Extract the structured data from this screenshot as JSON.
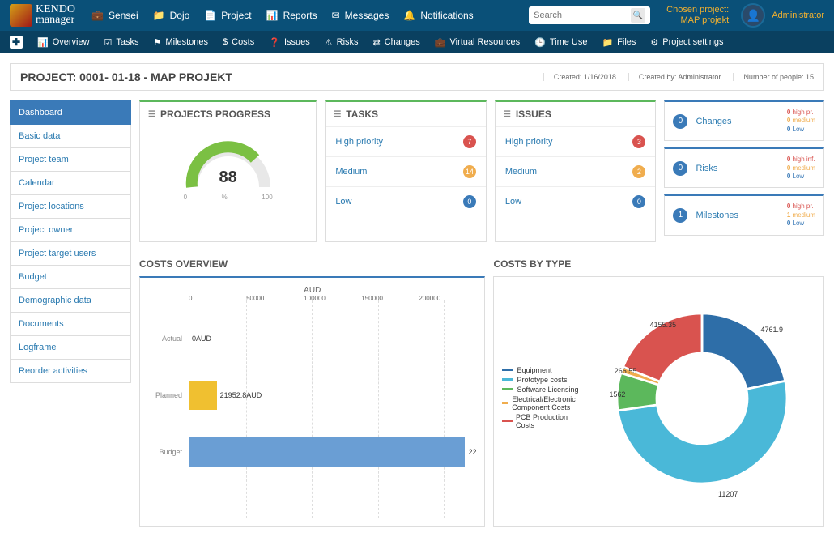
{
  "logo": {
    "line1": "KENDO",
    "line2": "manager"
  },
  "topnav": [
    {
      "icon": "briefcase",
      "label": "Sensei"
    },
    {
      "icon": "folder",
      "label": "Dojo"
    },
    {
      "icon": "document",
      "label": "Project"
    },
    {
      "icon": "chart",
      "label": "Reports"
    },
    {
      "icon": "envelope",
      "label": "Messages"
    },
    {
      "icon": "bell",
      "label": "Notifications"
    }
  ],
  "search": {
    "placeholder": "Search"
  },
  "chosen": {
    "line1": "Chosen project:",
    "line2": "MAP projekt"
  },
  "admin": {
    "label": "Administrator"
  },
  "subnav": [
    {
      "icon": "chart",
      "label": "Overview"
    },
    {
      "icon": "tasks",
      "label": "Tasks"
    },
    {
      "icon": "flag",
      "label": "Milestones"
    },
    {
      "icon": "dollar",
      "label": "Costs"
    },
    {
      "icon": "question",
      "label": "Issues"
    },
    {
      "icon": "warning",
      "label": "Risks"
    },
    {
      "icon": "exchange",
      "label": "Changes"
    },
    {
      "icon": "briefcase",
      "label": "Virtual Resources"
    },
    {
      "icon": "clock",
      "label": "Time Use"
    },
    {
      "icon": "folder",
      "label": "Files"
    },
    {
      "icon": "gear",
      "label": "Project settings"
    }
  ],
  "project": {
    "title": "PROJECT: 0001- 01-18 - MAP PROJEKT",
    "meta": [
      "Created: 1/16/2018",
      "Created by: Administrator",
      "Number of people: 15"
    ]
  },
  "sidebar": [
    "Dashboard",
    "Basic data",
    "Project team",
    "Calendar",
    "Project locations",
    "Project owner",
    "Project target users",
    "Budget",
    "Demographic data",
    "Documents",
    "Logframe",
    "Reorder activities"
  ],
  "cards": {
    "progress": {
      "title": "PROJECTS PROGRESS",
      "value": "88",
      "min": "0",
      "mid": "%",
      "max": "100"
    },
    "tasks": {
      "title": "TASKS",
      "rows": [
        {
          "label": "High priority",
          "count": "7",
          "color": "#d9534f"
        },
        {
          "label": "Medium",
          "count": "14",
          "color": "#f0ad4e"
        },
        {
          "label": "Low",
          "count": "0",
          "color": "#3a7ab8"
        }
      ]
    },
    "issues": {
      "title": "ISSUES",
      "rows": [
        {
          "label": "High priority",
          "count": "3",
          "color": "#d9534f"
        },
        {
          "label": "Medium",
          "count": "2",
          "color": "#f0ad4e"
        },
        {
          "label": "Low",
          "count": "0",
          "color": "#3a7ab8"
        }
      ]
    },
    "mini": [
      {
        "count": "0",
        "label": "Changes",
        "lines": [
          {
            "n": "0",
            "t": "high pr.",
            "c": "high"
          },
          {
            "n": "0",
            "t": "medium",
            "c": "med"
          },
          {
            "n": "0",
            "t": "Low",
            "c": "low"
          }
        ]
      },
      {
        "count": "0",
        "label": "Risks",
        "lines": [
          {
            "n": "0",
            "t": "high inf.",
            "c": "high"
          },
          {
            "n": "0",
            "t": "medium",
            "c": "med"
          },
          {
            "n": "0",
            "t": "Low",
            "c": "low"
          }
        ]
      },
      {
        "count": "1",
        "label": "Milestones",
        "lines": [
          {
            "n": "0",
            "t": "high pr.",
            "c": "high"
          },
          {
            "n": "1",
            "t": "medium",
            "c": "med"
          },
          {
            "n": "0",
            "t": "Low",
            "c": "low"
          }
        ]
      }
    ]
  },
  "costs_overview": {
    "title": "COSTS OVERVIEW"
  },
  "costs_by_type": {
    "title": "COSTS BY TYPE"
  },
  "chart_data": [
    {
      "type": "bar",
      "title": "AUD",
      "orientation": "horizontal",
      "categories": [
        "Actual",
        "Planned",
        "Budget"
      ],
      "values": [
        0,
        21952.8,
        225000
      ],
      "labels": [
        "0AUD",
        "21952.8AUD",
        "22"
      ],
      "colors": [
        "#5bc0de",
        "#f0c030",
        "#6a9ed4"
      ],
      "xticks": [
        0,
        50000,
        100000,
        150000,
        200000
      ],
      "xlim": [
        0,
        225000
      ],
      "xlabel": "",
      "ylabel": ""
    },
    {
      "type": "pie",
      "title": "",
      "donut": true,
      "series": [
        {
          "name": "Equipment",
          "value": 4761.9,
          "color": "#2e6ea8"
        },
        {
          "name": "Prototype costs",
          "value": 11207,
          "color": "#4ab8d8"
        },
        {
          "name": "Software Licensing",
          "value": 1562,
          "color": "#5cb85c"
        },
        {
          "name": "Electrical/Electronic Component Costs",
          "value": 266.55,
          "color": "#f0ad4e"
        },
        {
          "name": "PCB Production Costs",
          "value": 4155.35,
          "color": "#d9534f"
        }
      ]
    }
  ]
}
